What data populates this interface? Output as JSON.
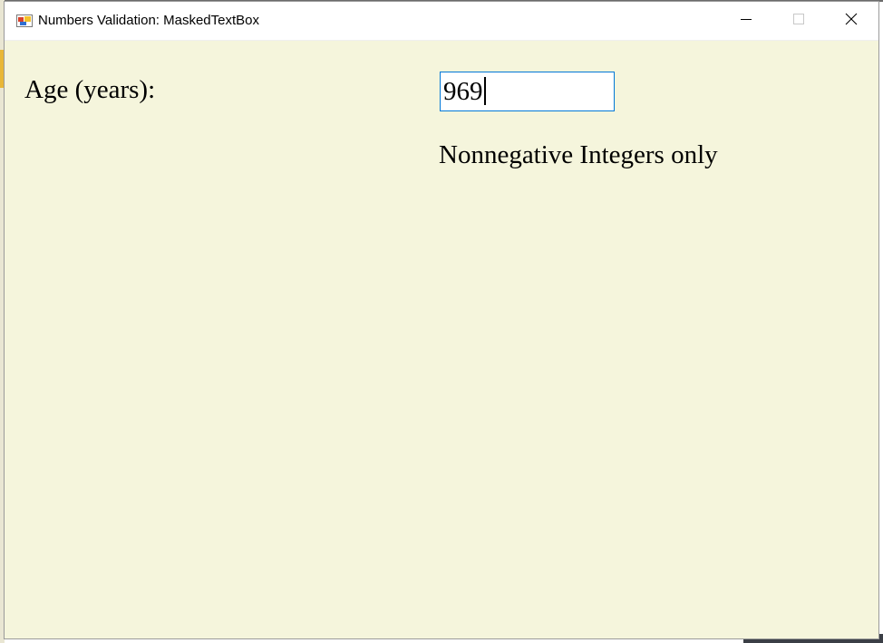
{
  "window": {
    "title": "Numbers Validation: MaskedTextBox",
    "icon": "winforms-app-icon",
    "caption_buttons": [
      "minimize",
      "maximize",
      "close"
    ]
  },
  "form": {
    "age_label": "Age (years):",
    "age_value": "969",
    "hint": "Nonnegative Integers only"
  },
  "colors": {
    "form_background": "#f5f5dc",
    "input_focus_border": "#0078d7",
    "titlebar_background": "#ffffff"
  }
}
